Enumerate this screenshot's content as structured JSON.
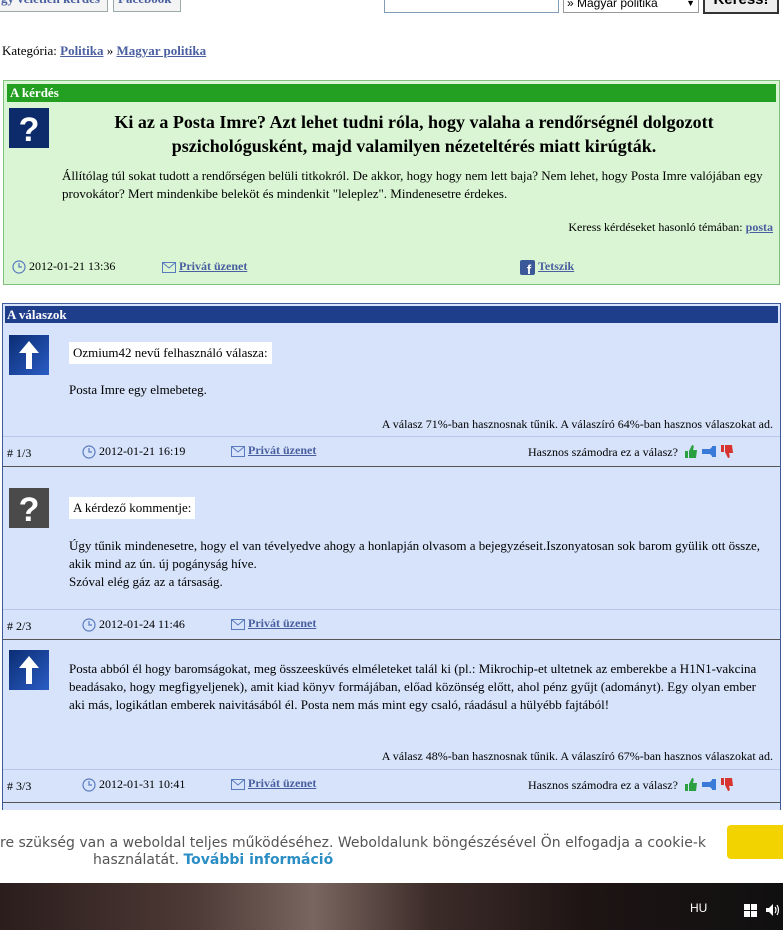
{
  "topbar": {
    "random_button": "gy véletlen kérdés",
    "facebook_button": "Facebook",
    "search_placeholder": "",
    "category_select": "» Magyar politika",
    "search_button": "Keress!"
  },
  "breadcrumb": {
    "prefix": "Kategória:",
    "category": "Politika",
    "separator": "»",
    "subcategory": "Magyar politika"
  },
  "question": {
    "header": "A kérdés",
    "title": "Ki az a Posta Imre? Azt lehet tudni róla, hogy valaha a rendőrségnél dolgozott pszichológusként, majd valamilyen nézeteltérés miatt kirúgták.",
    "body": "Állítólag túl sokat tudott a rendőrségen belüli titkokról. De akkor, hogy hogy nem lett baja? Nem lehet, hogy Posta Imre valójában egy provokátor? Mert mindenkibe beleköt és mindenkit \"leleplez\". Mindenesetre érdekes.",
    "similar_text": "Keress kérdéseket hasonló témában:",
    "similar_link": "posta",
    "date": "2012-01-21 13:36",
    "private_message": "Privát üzenet",
    "like": "Tetszik"
  },
  "answers": {
    "header": "A válaszok",
    "useful_question": "Hasznos számodra ez a válasz?",
    "private_message": "Privát üzenet",
    "items": [
      {
        "who": "Ozmium42 nevű felhasználó válasza:",
        "text": "Posta Imre egy elmebeteg.",
        "stats": "A válasz 71%-ban hasznosnak tűnik. A válaszíró 64%-ban hasznos válaszokat ad.",
        "number": "# 1/3",
        "date": "2012-01-21 16:19"
      },
      {
        "who": "A kérdező kommentje:",
        "text_lines": [
          "Úgy tűnik mindenesetre, hogy el van tévelyedve ahogy a honlapján olvasom a bejegyzéseit.Iszonyatosan sok barom gyülik ott össze, akik mind az ún. új pogányság híve.",
          "Szóval elég gáz az a társaság."
        ],
        "number": "# 2/3",
        "date": "2012-01-24 11:46"
      },
      {
        "text": "Posta abból él hogy baromságokat, meg összeesküvés elméleteket talál ki (pl.: Mikrochip-et ultetnek az emberekbe a H1N1-vakcina beadásako, hogy megfigyeljenek), amit kiad könyv formájában, előad közönség előtt, ahol pénz gyűjt (adományt). Egy olyan ember aki más, logikátlan emberek naivitásából él. Posta nem más mint egy csaló, ráadásul a hülyébb fajtából!",
        "stats": "A válasz 48%-ban hasznosnak tűnik. A válaszíró 67%-ban hasznos válaszokat ad.",
        "number": "# 3/3",
        "date": "2012-01-31 10:41"
      }
    ]
  },
  "cookie": {
    "text_line1": "re szükség van a weboldal teljes működéséhez. Weboldalunk böngészésével Ön elfogadja a cookie-k",
    "text_line2": "használatát.",
    "more_link": "További információ"
  },
  "taskbar": {
    "language": "HU"
  },
  "colors": {
    "question_bg": "#d9f5d3",
    "question_header": "#23a021",
    "answers_bg": "#d6e3fa",
    "answers_header": "#1e3d8a",
    "link": "#4a5fa0",
    "cookie_button": "#f2d300"
  }
}
